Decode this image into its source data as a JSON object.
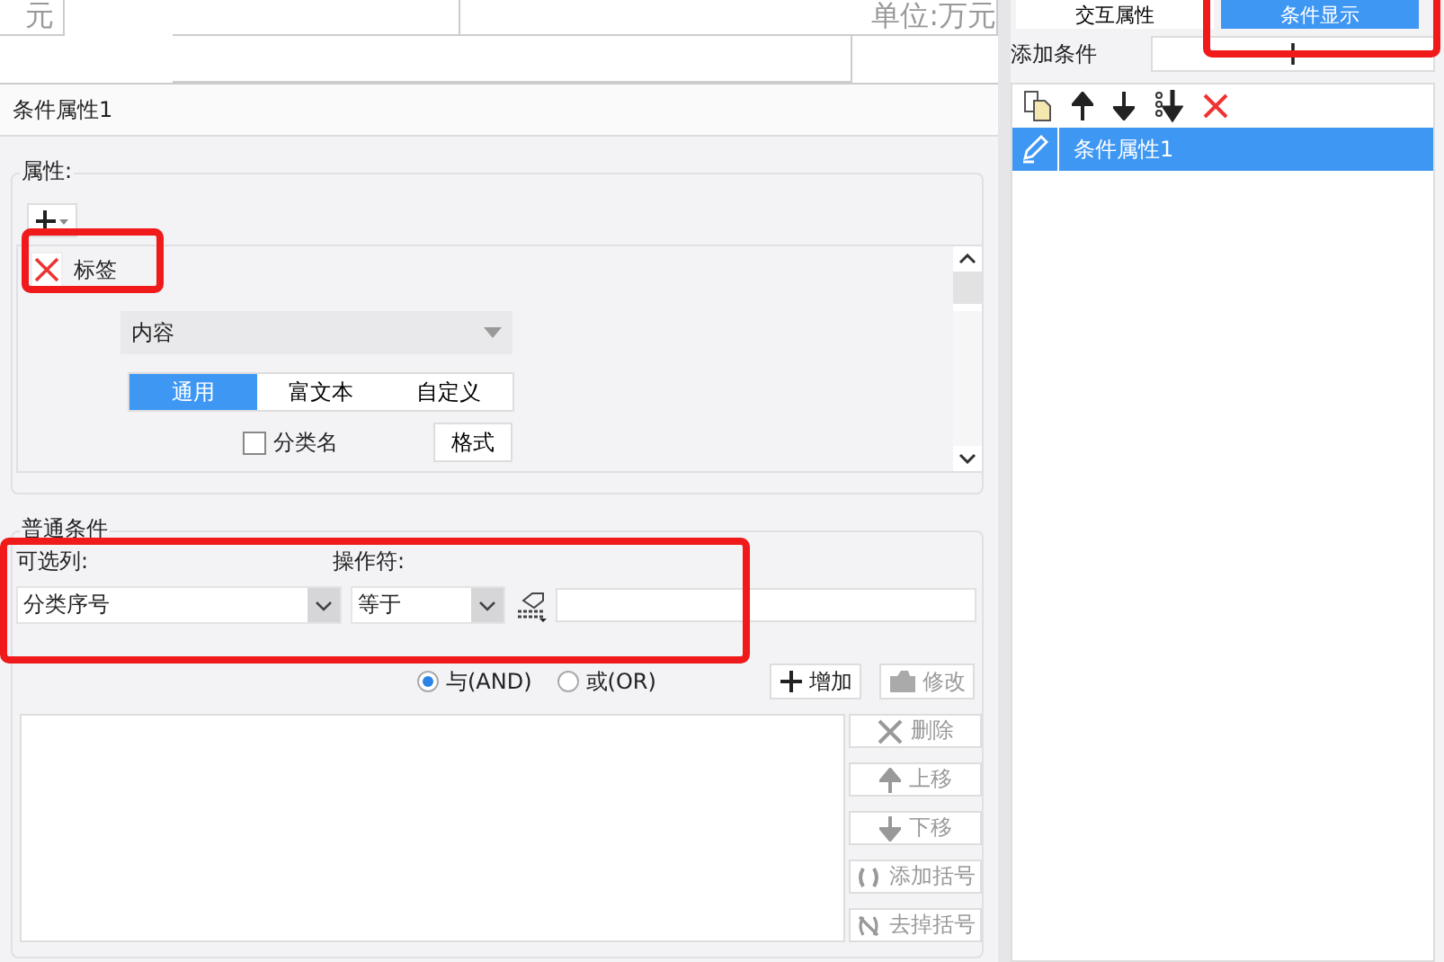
{
  "sheet": {
    "cells": [
      {
        "kind": "unit",
        "text": "元"
      },
      {
        "kind": "unit",
        "text": "单位:万元"
      }
    ]
  },
  "dialog": {
    "title": "条件属性1",
    "attributes": {
      "legend": "属性:",
      "item": {
        "label": "标签"
      },
      "content": {
        "value": "内容"
      },
      "tabs": [
        {
          "label": "通用",
          "selected": true
        },
        {
          "label": "富文本",
          "selected": false
        },
        {
          "label": "自定义",
          "selected": false
        }
      ],
      "checkbox": {
        "label": "分类名",
        "checked": false
      },
      "format_button": "格式"
    },
    "conditions": {
      "legend": "普通条件",
      "column_label": "可选列:",
      "column_value": "分类序号",
      "operator_label": "操作符:",
      "operator_value": "等于",
      "logic": [
        {
          "label": "与(AND)",
          "selected": true
        },
        {
          "label": "或(OR)",
          "selected": false
        }
      ],
      "actions": [
        {
          "label": "增加",
          "disabled": false
        },
        {
          "label": "修改",
          "disabled": true
        }
      ],
      "side_buttons": [
        {
          "label": "删除",
          "disabled": true
        },
        {
          "label": "上移",
          "disabled": true
        },
        {
          "label": "下移",
          "disabled": true
        },
        {
          "label": "添加括号",
          "disabled": true
        },
        {
          "label": "去掉括号",
          "disabled": true
        }
      ]
    }
  },
  "side_panel": {
    "tabs": [
      {
        "label": "交互属性",
        "selected": false
      },
      {
        "label": "条件显示",
        "selected": true
      }
    ],
    "add_condition_label": "添加条件",
    "items": [
      {
        "label": "条件属性1",
        "selected": true
      }
    ]
  }
}
